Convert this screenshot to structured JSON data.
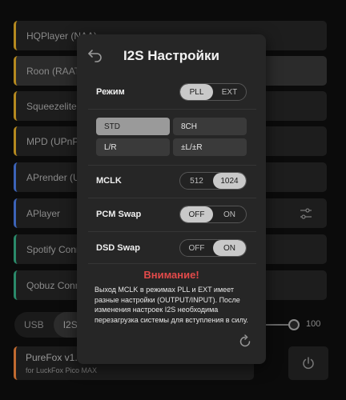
{
  "background": {
    "items": [
      {
        "label": "HQPlayer (NAA)"
      },
      {
        "label": "Roon (RAAT)"
      },
      {
        "label": "Squeezelite"
      },
      {
        "label": "MPD (UPnP)"
      },
      {
        "label": "APrender (U"
      },
      {
        "label": "APlayer"
      },
      {
        "label": "Spotify Conn"
      },
      {
        "label": "Qobuz Conn"
      }
    ],
    "tabs": [
      "USB",
      "I2S"
    ],
    "volume": "100",
    "footer": {
      "title": "PureFox v1.0",
      "subtitle": "for LuckFox Pico MAX"
    }
  },
  "modal": {
    "title": "I2S Настройки",
    "mode": {
      "label": "Режим",
      "options": [
        "PLL",
        "EXT"
      ],
      "selected": "PLL"
    },
    "channel_buttons": [
      "STD",
      "8CH",
      "L/R",
      "±L/±R"
    ],
    "channel_selected": "STD",
    "mclk": {
      "label": "MCLK",
      "options": [
        "512",
        "1024"
      ],
      "selected": "1024"
    },
    "pcm_swap": {
      "label": "PCM Swap",
      "options": [
        "OFF",
        "ON"
      ],
      "selected": "OFF"
    },
    "dsd_swap": {
      "label": "DSD Swap",
      "options": [
        "OFF",
        "ON"
      ],
      "selected": "ON"
    },
    "warning_title": "Внимание!",
    "warning_text": "Выход MCLK в режимах PLL и EXT имеет разные настройки (OUTPUT/INPUT). После изменения настроек I2S необходима перезагрузка системы для вступления в силу."
  }
}
